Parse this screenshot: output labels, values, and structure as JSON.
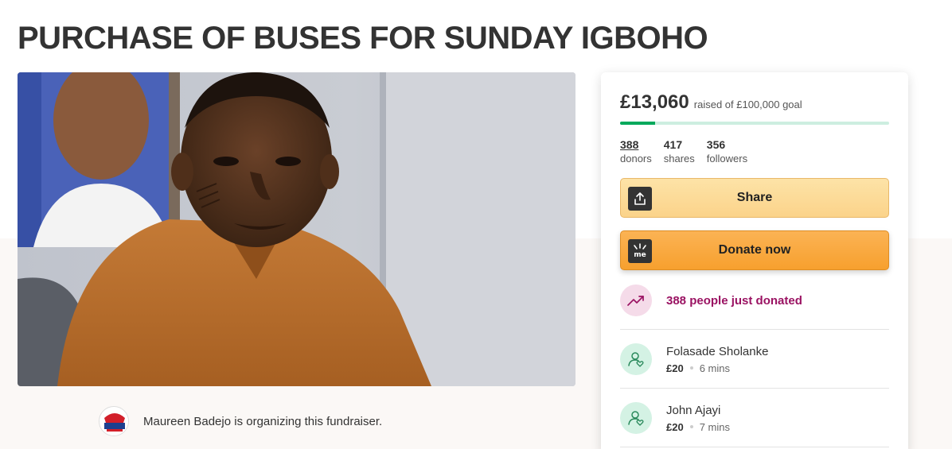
{
  "page": {
    "title": "PURCHASE OF BUSES FOR SUNDAY IGBOHO"
  },
  "hero": {
    "image_icon": "portrait-photo"
  },
  "organizer": {
    "text": "Maureen Badejo is organizing this fundraiser.",
    "avatar_icon": "organizer-avatar-logo"
  },
  "donation_panel": {
    "raised": "£13,060",
    "goal_text": "raised of £100,000 goal",
    "progress_fraction": 0.1306,
    "stats": [
      {
        "value": "388",
        "label": "donors"
      },
      {
        "value": "417",
        "label": "shares"
      },
      {
        "value": "356",
        "label": "followers"
      }
    ],
    "share_label": "Share",
    "donate_label": "Donate now",
    "trend_text": "388 people just donated",
    "donors": [
      {
        "name": "Folasade Sholanke",
        "amount": "£20",
        "time": "6 mins"
      },
      {
        "name": "John Ajayi",
        "amount": "£20",
        "time": "7 mins"
      }
    ]
  },
  "colors": {
    "progress": "#02a95c",
    "trend_text": "#9a1262",
    "donate_button": "#f7a02e",
    "share_button": "#fbd38a"
  }
}
